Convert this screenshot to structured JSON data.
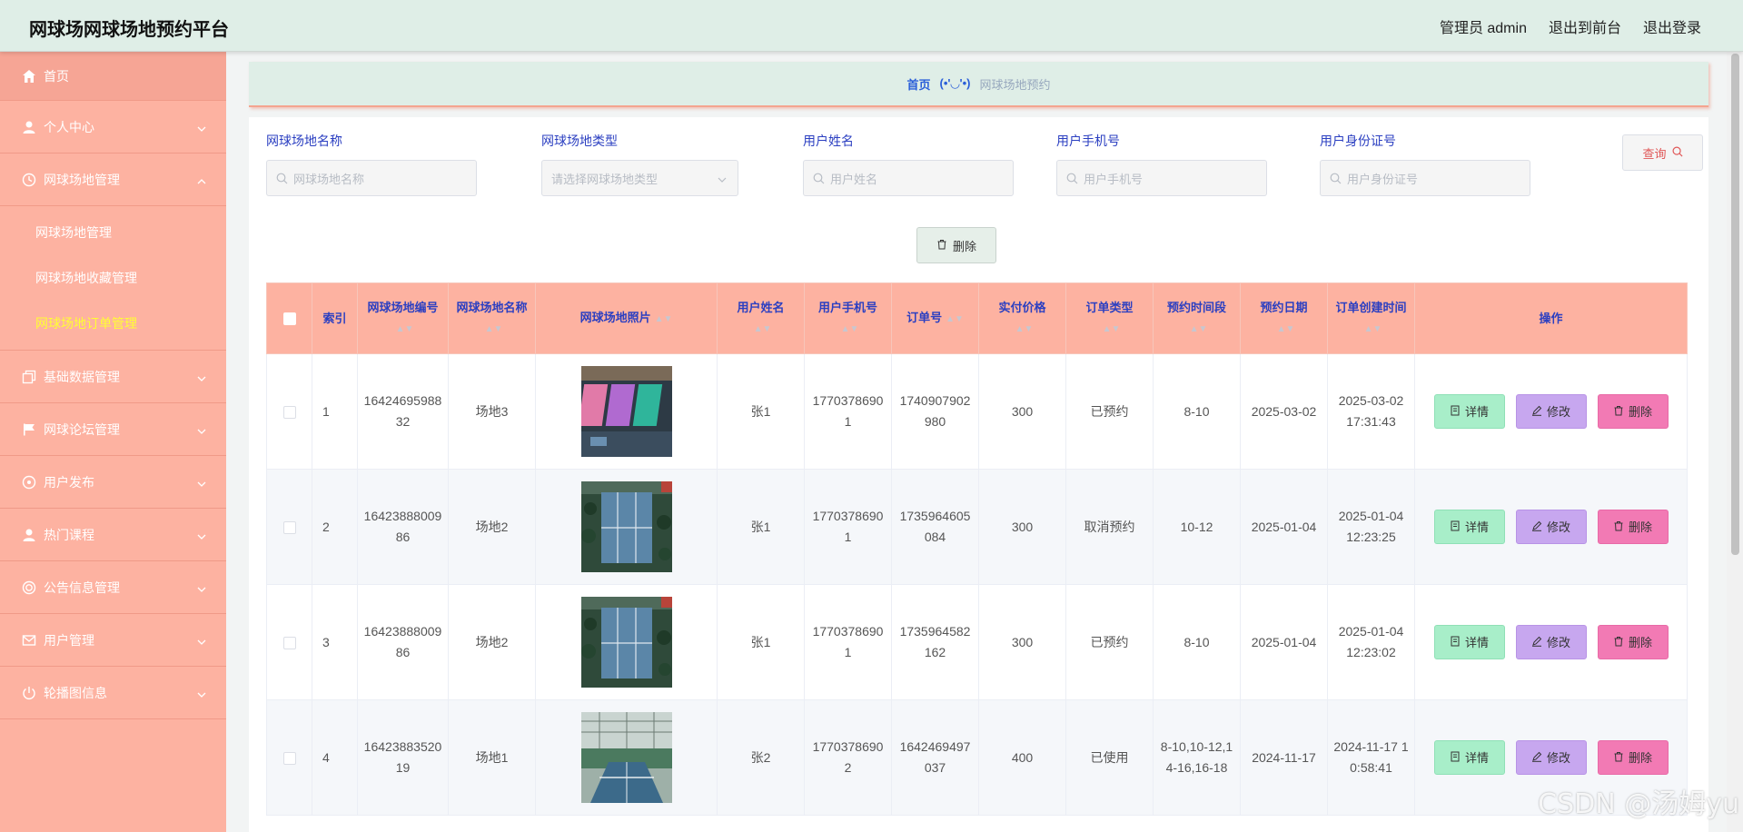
{
  "header": {
    "title": "网球场网球场地预约平台",
    "admin_label": "管理员 admin",
    "front_link": "退出到前台",
    "logout_link": "退出登录"
  },
  "sidebar": {
    "home": "首页",
    "personal": "个人中心",
    "court_mgmt": "网球场地管理",
    "sub_court": "网球场地管理",
    "sub_fav": "网球场地收藏管理",
    "sub_order": "网球场地订单管理",
    "basic": "基础数据管理",
    "forum": "网球论坛管理",
    "user_post": "用户发布",
    "courses": "热门课程",
    "notice": "公告信息管理",
    "user_mgmt": "用户管理",
    "carousel": "轮播图信息"
  },
  "breadcrumb": {
    "home": "首页",
    "face": "(•'◡'•)",
    "current": "网球场地预约"
  },
  "filters": {
    "name_label": "网球场地名称",
    "name_placeholder": "网球场地名称",
    "type_label": "网球场地类型",
    "type_placeholder": "请选择网球场地类型",
    "user_label": "用户姓名",
    "user_placeholder": "用户姓名",
    "phone_label": "用户手机号",
    "phone_placeholder": "用户手机号",
    "id_label": "用户身份证号",
    "id_placeholder": "用户身份证号",
    "query_button": "查询",
    "delete_button": "删除"
  },
  "table": {
    "headers": {
      "index": "索引",
      "court_no": "网球场地编号",
      "court_name": "网球场地名称",
      "photo": "网球场地照片",
      "user_name": "用户姓名",
      "user_phone": "用户手机号",
      "order_no": "订单号",
      "price": "实付价格",
      "order_type": "订单类型",
      "time_slot": "预约时间段",
      "date": "预约日期",
      "created": "订单创建时间",
      "ops": "操作"
    },
    "rows": [
      {
        "index": "1",
        "court_no": "1642469598832",
        "court_name": "场地3",
        "user_name": "张1",
        "user_phone": "17703786901",
        "order_no": "1740907902980",
        "price": "300",
        "order_type": "已预约",
        "time_slot": "8-10",
        "date": "2025-03-02",
        "created": "2025-03-02 17:31:43",
        "photo_kind": "colored-courts"
      },
      {
        "index": "2",
        "court_no": "1642388800986",
        "court_name": "场地2",
        "user_name": "张1",
        "user_phone": "17703786901",
        "order_no": "1735964605084",
        "price": "300",
        "order_type": "取消预约",
        "time_slot": "10-12",
        "date": "2025-01-04",
        "created": "2025-01-04 12:23:25",
        "photo_kind": "aerial-courts"
      },
      {
        "index": "3",
        "court_no": "1642388800986",
        "court_name": "场地2",
        "user_name": "张1",
        "user_phone": "17703786901",
        "order_no": "1735964582162",
        "price": "300",
        "order_type": "已预约",
        "time_slot": "8-10",
        "date": "2025-01-04",
        "created": "2025-01-04 12:23:02",
        "photo_kind": "aerial-courts"
      },
      {
        "index": "4",
        "court_no": "1642388352019",
        "court_name": "场地1",
        "user_name": "张2",
        "user_phone": "17703786902",
        "order_no": "1642469497037",
        "price": "400",
        "order_type": "已使用",
        "time_slot": "8-10,10-12,14-16,16-18",
        "date": "2024-11-17",
        "created": "2024-11-17 10:58:41",
        "photo_kind": "indoor-court"
      }
    ],
    "btn_detail": "详情",
    "btn_edit": "修改",
    "btn_delete": "删除"
  },
  "watermark": "CSDN @汤姆yu",
  "colors": {
    "header_bg": "#dfeee7",
    "sidebar_bg": "#fdb2a1",
    "table_head_bg": "#fdb2a1",
    "label_blue": "#2b3fc1",
    "active_sub": "#ffff33",
    "detail_btn": "#a8eec9",
    "edit_btn": "#c7a7ef",
    "delete_btn": "#f27ab4"
  }
}
